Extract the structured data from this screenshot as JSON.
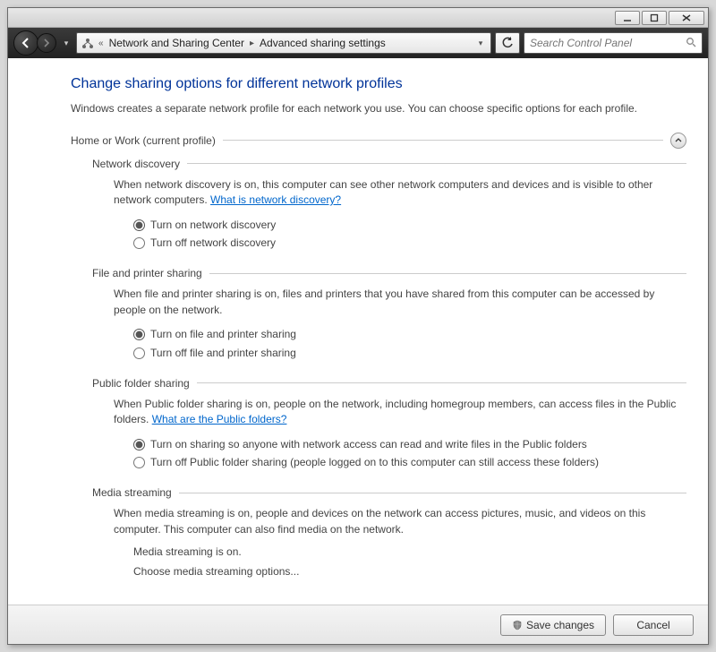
{
  "breadcrumb": {
    "segments": [
      "Network and Sharing Center",
      "Advanced sharing settings"
    ]
  },
  "search": {
    "placeholder": "Search Control Panel"
  },
  "page": {
    "title": "Change sharing options for different network profiles",
    "description": "Windows creates a separate network profile for each network you use. You can choose specific options for each profile."
  },
  "profile": {
    "label": "Home or Work (current profile)"
  },
  "sections": {
    "network_discovery": {
      "title": "Network discovery",
      "desc": "When network discovery is on, this computer can see other network computers and devices and is visible to other network computers. ",
      "link": "What is network discovery?",
      "radios": [
        {
          "label": "Turn on network discovery",
          "checked": true
        },
        {
          "label": "Turn off network discovery",
          "checked": false
        }
      ]
    },
    "file_printer": {
      "title": "File and printer sharing",
      "desc": "When file and printer sharing is on, files and printers that you have shared from this computer can be accessed by people on the network.",
      "radios": [
        {
          "label": "Turn on file and printer sharing",
          "checked": true
        },
        {
          "label": "Turn off file and printer sharing",
          "checked": false
        }
      ]
    },
    "public_folder": {
      "title": "Public folder sharing",
      "desc": "When Public folder sharing is on, people on the network, including homegroup members, can access files in the Public folders. ",
      "link": "What are the Public folders?",
      "radios": [
        {
          "label": "Turn on sharing so anyone with network access can read and write files in the Public folders",
          "checked": true
        },
        {
          "label": "Turn off Public folder sharing (people logged on to this computer can still access these folders)",
          "checked": false
        }
      ]
    },
    "media_streaming": {
      "title": "Media streaming",
      "desc": "When media streaming is on, people and devices on the network can access pictures, music, and videos on this computer. This computer can also find media on the network.",
      "status": "Media streaming is on.",
      "options_link": "Choose media streaming options..."
    }
  },
  "footer": {
    "save": "Save changes",
    "cancel": "Cancel"
  }
}
